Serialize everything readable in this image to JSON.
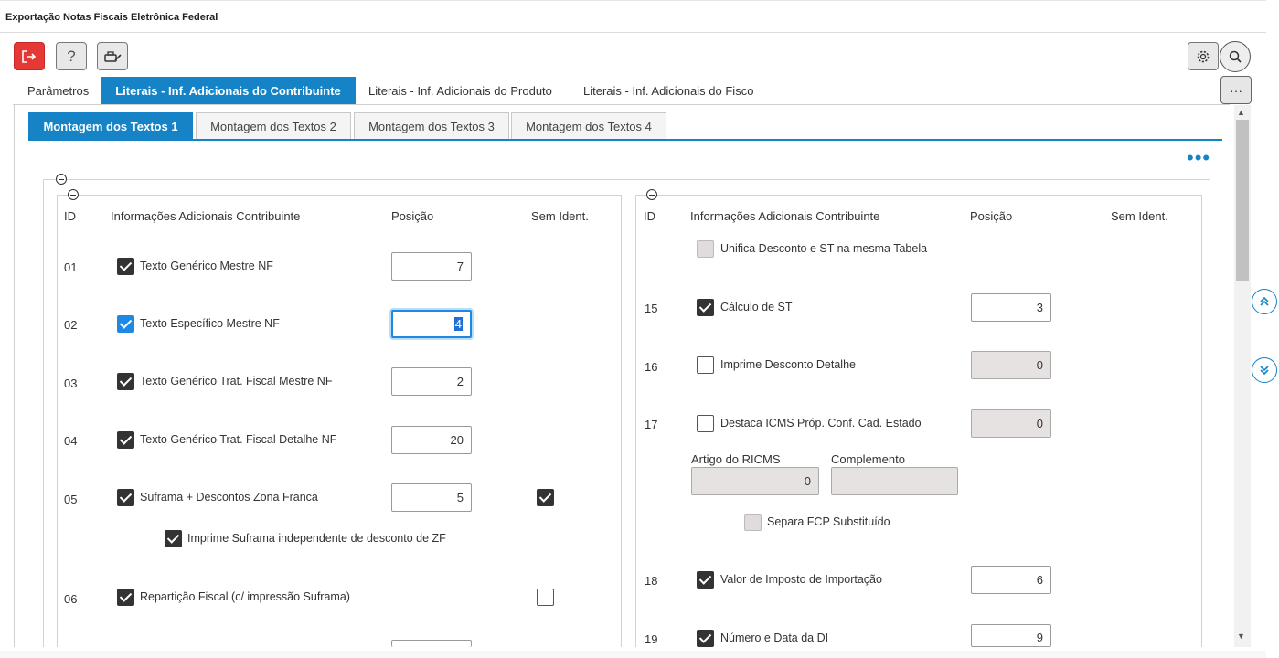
{
  "window": {
    "title": "Exportação Notas Fiscais Eletrônica Federal"
  },
  "toolbar": {
    "exit_icon": "exit-icon",
    "help_label": "?",
    "print_icon": "print-icon",
    "settings_icon": "gear-icon",
    "search_icon": "search-icon",
    "more_label": "···"
  },
  "top_tabs": [
    {
      "label": "Parâmetros",
      "active": false
    },
    {
      "label": "Literais - Inf. Adicionais do Contribuinte",
      "active": true
    },
    {
      "label": "Literais - Inf. Adicionais do Produto",
      "active": false
    },
    {
      "label": "Literais - Inf. Adicionais do Fisco",
      "active": false
    }
  ],
  "sub_tabs": [
    {
      "label": "Montagem dos Textos 1",
      "active": true
    },
    {
      "label": "Montagem dos Textos 2",
      "active": false
    },
    {
      "label": "Montagem dos Textos 3",
      "active": false
    },
    {
      "label": "Montagem dos Textos 4",
      "active": false
    }
  ],
  "headers": {
    "id": "ID",
    "info": "Informações Adicionais Contribuinte",
    "pos": "Posição",
    "sem": "Sem Ident."
  },
  "left_rows": [
    {
      "id": "01",
      "label": "Texto Genérico Mestre NF",
      "checked": true,
      "pos": "7"
    },
    {
      "id": "02",
      "label": "Texto Específico Mestre NF",
      "checked": true,
      "pos": "4"
    },
    {
      "id": "03",
      "label": "Texto Genérico Trat. Fiscal Mestre NF",
      "checked": true,
      "pos": "2"
    },
    {
      "id": "04",
      "label": "Texto Genérico Trat. Fiscal Detalhe NF",
      "checked": true,
      "pos": "20"
    },
    {
      "id": "05",
      "label": "Suframa + Descontos Zona Franca",
      "checked": true,
      "pos": "5",
      "sem_ident": true
    },
    {
      "id": "",
      "label": "Imprime Suframa independente de desconto de ZF",
      "checked": true
    },
    {
      "id": "06",
      "label": "Repartição Fiscal (c/ impressão Suframa)",
      "checked": true,
      "sem_ident": false
    }
  ],
  "right_rows": [
    {
      "id": "",
      "label": "Unifica Desconto e ST na mesma Tabela",
      "checked": false,
      "disabled": true
    },
    {
      "id": "15",
      "label": "Cálculo de ST",
      "checked": true,
      "pos": "3"
    },
    {
      "id": "16",
      "label": "Imprime Desconto Detalhe",
      "checked": false,
      "pos": "0"
    },
    {
      "id": "17",
      "label": "Destaca ICMS Próp. Conf. Cad. Estado",
      "checked": false,
      "pos": "0"
    },
    {
      "id": "18",
      "label": "Valor de Imposto de Importação",
      "checked": true,
      "pos": "6"
    },
    {
      "id": "19",
      "label": "Número e Data da DI",
      "checked": true,
      "pos": "9"
    }
  ],
  "artigo": {
    "label": "Artigo do RICMS",
    "value": "0"
  },
  "complemento": {
    "label": "Complemento",
    "value": ""
  },
  "separa_fcp": {
    "label": "Separa FCP Substituído",
    "checked": false
  }
}
